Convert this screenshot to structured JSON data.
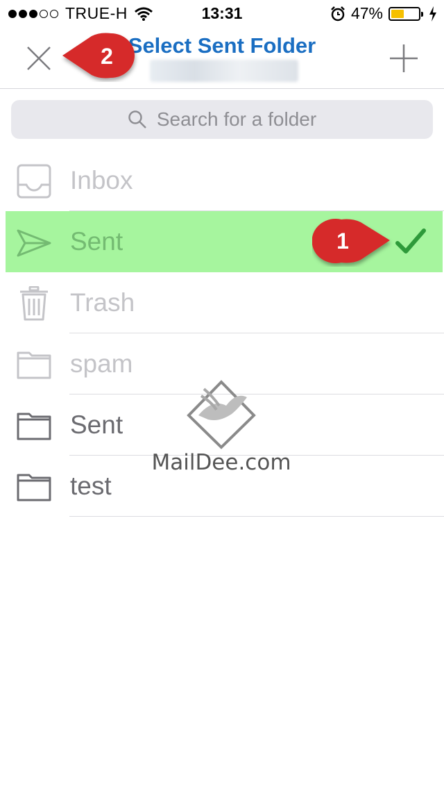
{
  "status_bar": {
    "carrier": "TRUE-H",
    "time": "13:31",
    "battery_percent": "47%",
    "battery_level": 0.47,
    "signal_dots_filled": 3,
    "signal_dots_total": 5,
    "battery_color": "#f6c000"
  },
  "nav": {
    "title": "Select Sent Folder",
    "subtitle_blurred": true,
    "close_icon": "close-icon",
    "add_icon": "plus-icon",
    "title_color": "#1a6ec2"
  },
  "search": {
    "placeholder": "Search for a folder",
    "icon": "search-icon"
  },
  "folders": [
    {
      "label": "Inbox",
      "icon": "inbox-icon",
      "state": "disabled"
    },
    {
      "label": "Sent",
      "icon": "send-icon",
      "state": "selected",
      "checked": true
    },
    {
      "label": "Trash",
      "icon": "trash-icon",
      "state": "disabled"
    },
    {
      "label": "spam",
      "icon": "folder-icon",
      "state": "disabled"
    },
    {
      "label": "Sent",
      "icon": "folder-icon",
      "state": "enabled"
    },
    {
      "label": "test",
      "icon": "folder-icon",
      "state": "enabled"
    }
  ],
  "annotations": {
    "badge_1": "1",
    "badge_2": "2",
    "badge_color": "#d62b2b",
    "highlight_color": "#a6f59e"
  },
  "watermark": {
    "text": "MailDee.com"
  }
}
